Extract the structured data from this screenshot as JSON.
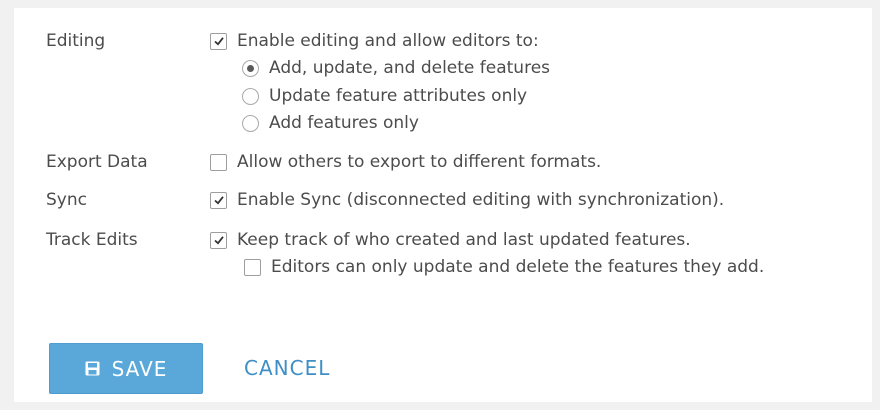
{
  "colors": {
    "accent": "#5aa8da",
    "link": "#3f8fc6",
    "text": "#4c4c4c"
  },
  "settings": {
    "editing": {
      "label": "Editing",
      "enable": {
        "text": "Enable editing and allow editors to:",
        "checked": true
      },
      "options": [
        {
          "text": "Add, update, and delete features",
          "selected": true
        },
        {
          "text": "Update feature attributes only",
          "selected": false
        },
        {
          "text": "Add features only",
          "selected": false
        }
      ]
    },
    "export": {
      "label": "Export Data",
      "option": {
        "text": "Allow others to export to different formats.",
        "checked": false
      }
    },
    "sync": {
      "label": "Sync",
      "option": {
        "text": "Enable Sync (disconnected editing with synchronization).",
        "checked": true
      }
    },
    "track": {
      "label": "Track Edits",
      "option": {
        "text": "Keep track of who created and last updated features.",
        "checked": true
      },
      "sub_option": {
        "text": "Editors can only update and delete the features they add.",
        "checked": false
      }
    }
  },
  "actions": {
    "save": {
      "label": "SAVE",
      "icon": "save-icon"
    },
    "cancel": {
      "label": "CANCEL"
    }
  }
}
